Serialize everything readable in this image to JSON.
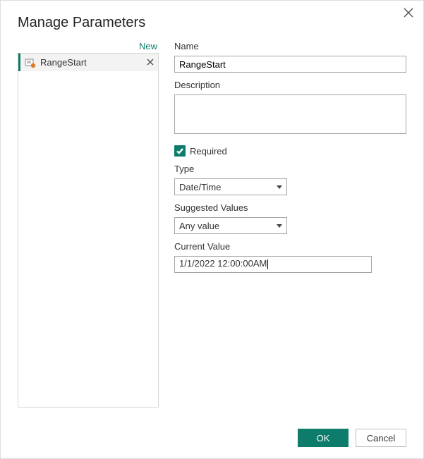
{
  "dialog": {
    "title": "Manage Parameters"
  },
  "left": {
    "new_label": "New",
    "params": [
      {
        "label": "RangeStart"
      }
    ]
  },
  "form": {
    "name_label": "Name",
    "name_value": "RangeStart",
    "description_label": "Description",
    "description_value": "",
    "required_label": "Required",
    "type_label": "Type",
    "type_value": "Date/Time",
    "suggested_label": "Suggested Values",
    "suggested_value": "Any value",
    "current_label": "Current Value",
    "current_value": "1/1/2022 12:00:00AM"
  },
  "footer": {
    "ok": "OK",
    "cancel": "Cancel"
  }
}
